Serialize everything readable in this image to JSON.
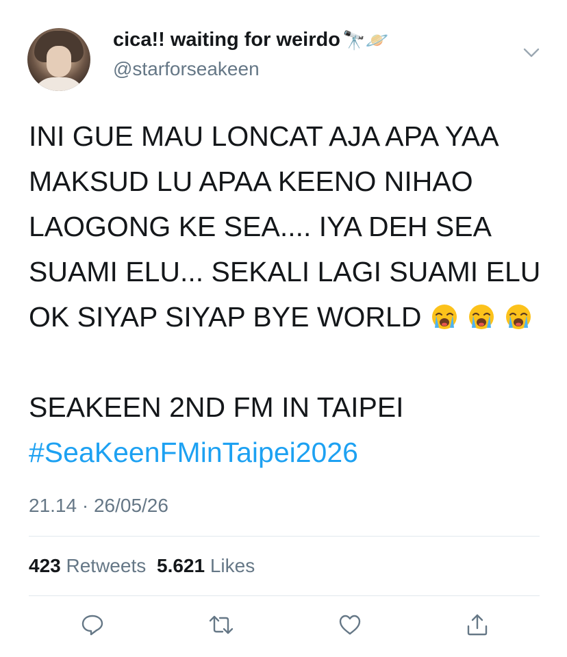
{
  "user": {
    "display_name": "cica!! waiting for weirdo",
    "name_emoji": "🔭🪐",
    "handle": "@starforseakeen"
  },
  "tweet": {
    "lines": [
      "INI GUE MAU LONCAT AJA APA YAA",
      "MAKSUD LU APAA KEENO NIHAO",
      "LAOGONG KE SEA.... IYA DEH SEA",
      "SUAMI ELU... SEKALI LAGI SUAMI ELU",
      "OK SIYAP SIYAP BYE WORLD"
    ],
    "emojis": [
      "loudly-crying-face",
      "loudly-crying-face",
      "loudly-crying-face"
    ],
    "event_line": "SEAKEEN 2ND FM IN TAIPEI",
    "hashtag": "#SeaKeenFMinTaipei2026"
  },
  "timestamp": "21.14 · 26/05/26",
  "stats": {
    "retweets_count": "423",
    "retweets_label": "Retweets",
    "likes_count": "5.621",
    "likes_label": "Likes"
  },
  "actions": [
    "reply-icon",
    "retweet-icon",
    "like-icon",
    "share-icon"
  ],
  "colors": {
    "text": "#14171a",
    "secondary": "#657786",
    "link": "#1da1f2",
    "divider": "#e1e8ed"
  }
}
